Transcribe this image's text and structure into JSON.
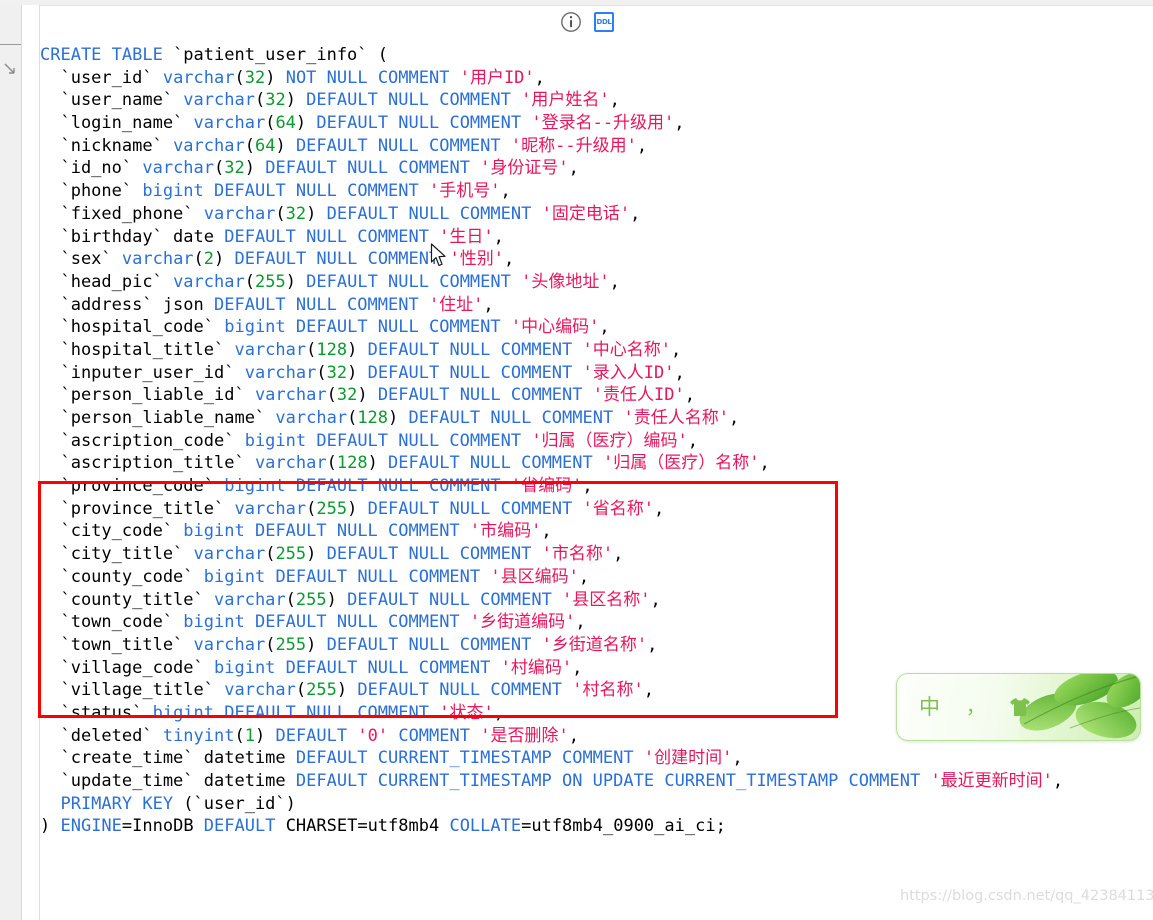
{
  "toolbar": {
    "info_icon": "info-circle-icon",
    "ddl_icon_label": "DDL"
  },
  "sidebar": {
    "collapse_icon": "chevron-collapse-icon"
  },
  "editor": {
    "language": "SQL",
    "statement_name": "CREATE TABLE patient_user_info",
    "colors": {
      "keyword": "#2b6fd8",
      "number": "#0a9a2e",
      "string": "#e8175d",
      "plain": "#000000",
      "annotation_box": "#ff0000"
    },
    "lines": [
      [
        {
          "t": "CREATE TABLE ",
          "c": "kw"
        },
        {
          "t": "`patient_user_info` (",
          "c": "plain"
        }
      ],
      [
        {
          "t": "  `user_id` ",
          "c": "plain"
        },
        {
          "t": "varchar",
          "c": "kw"
        },
        {
          "t": "(",
          "c": "plain"
        },
        {
          "t": "32",
          "c": "num"
        },
        {
          "t": ") ",
          "c": "plain"
        },
        {
          "t": "NOT NULL COMMENT ",
          "c": "kw"
        },
        {
          "t": "'用户ID'",
          "c": "str"
        },
        {
          "t": ",",
          "c": "plain"
        }
      ],
      [
        {
          "t": "  `user_name` ",
          "c": "plain"
        },
        {
          "t": "varchar",
          "c": "kw"
        },
        {
          "t": "(",
          "c": "plain"
        },
        {
          "t": "32",
          "c": "num"
        },
        {
          "t": ") ",
          "c": "plain"
        },
        {
          "t": "DEFAULT NULL COMMENT ",
          "c": "kw"
        },
        {
          "t": "'用户姓名'",
          "c": "str"
        },
        {
          "t": ",",
          "c": "plain"
        }
      ],
      [
        {
          "t": "  `login_name` ",
          "c": "plain"
        },
        {
          "t": "varchar",
          "c": "kw"
        },
        {
          "t": "(",
          "c": "plain"
        },
        {
          "t": "64",
          "c": "num"
        },
        {
          "t": ") ",
          "c": "plain"
        },
        {
          "t": "DEFAULT NULL COMMENT ",
          "c": "kw"
        },
        {
          "t": "'登录名--升级用'",
          "c": "str"
        },
        {
          "t": ",",
          "c": "plain"
        }
      ],
      [
        {
          "t": "  `nickname` ",
          "c": "plain"
        },
        {
          "t": "varchar",
          "c": "kw"
        },
        {
          "t": "(",
          "c": "plain"
        },
        {
          "t": "64",
          "c": "num"
        },
        {
          "t": ") ",
          "c": "plain"
        },
        {
          "t": "DEFAULT NULL COMMENT ",
          "c": "kw"
        },
        {
          "t": "'昵称--升级用'",
          "c": "str"
        },
        {
          "t": ",",
          "c": "plain"
        }
      ],
      [
        {
          "t": "  `id_no` ",
          "c": "plain"
        },
        {
          "t": "varchar",
          "c": "kw"
        },
        {
          "t": "(",
          "c": "plain"
        },
        {
          "t": "32",
          "c": "num"
        },
        {
          "t": ") ",
          "c": "plain"
        },
        {
          "t": "DEFAULT NULL COMMENT ",
          "c": "kw"
        },
        {
          "t": "'身份证号'",
          "c": "str"
        },
        {
          "t": ",",
          "c": "plain"
        }
      ],
      [
        {
          "t": "  `phone` ",
          "c": "plain"
        },
        {
          "t": "bigint",
          "c": "kw"
        },
        {
          "t": " ",
          "c": "plain"
        },
        {
          "t": "DEFAULT NULL COMMENT ",
          "c": "kw"
        },
        {
          "t": "'手机号'",
          "c": "str"
        },
        {
          "t": ",",
          "c": "plain"
        }
      ],
      [
        {
          "t": "  `fixed_phone` ",
          "c": "plain"
        },
        {
          "t": "varchar",
          "c": "kw"
        },
        {
          "t": "(",
          "c": "plain"
        },
        {
          "t": "32",
          "c": "num"
        },
        {
          "t": ") ",
          "c": "plain"
        },
        {
          "t": "DEFAULT NULL COMMENT ",
          "c": "kw"
        },
        {
          "t": "'固定电话'",
          "c": "str"
        },
        {
          "t": ",",
          "c": "plain"
        }
      ],
      [
        {
          "t": "  `birthday` date ",
          "c": "plain"
        },
        {
          "t": "DEFAULT NULL COMMENT ",
          "c": "kw"
        },
        {
          "t": "'生日'",
          "c": "str"
        },
        {
          "t": ",",
          "c": "plain"
        }
      ],
      [
        {
          "t": "  `sex` ",
          "c": "plain"
        },
        {
          "t": "varchar",
          "c": "kw"
        },
        {
          "t": "(",
          "c": "plain"
        },
        {
          "t": "2",
          "c": "num"
        },
        {
          "t": ") ",
          "c": "plain"
        },
        {
          "t": "DEFAULT NULL COMMENT ",
          "c": "kw"
        },
        {
          "t": "'性别'",
          "c": "str"
        },
        {
          "t": ",",
          "c": "plain"
        }
      ],
      [
        {
          "t": "  `head_pic` ",
          "c": "plain"
        },
        {
          "t": "varchar",
          "c": "kw"
        },
        {
          "t": "(",
          "c": "plain"
        },
        {
          "t": "255",
          "c": "num"
        },
        {
          "t": ") ",
          "c": "plain"
        },
        {
          "t": "DEFAULT NULL COMMENT ",
          "c": "kw"
        },
        {
          "t": "'头像地址'",
          "c": "str"
        },
        {
          "t": ",",
          "c": "plain"
        }
      ],
      [
        {
          "t": "  `address` json ",
          "c": "plain"
        },
        {
          "t": "DEFAULT NULL COMMENT ",
          "c": "kw"
        },
        {
          "t": "'住址'",
          "c": "str"
        },
        {
          "t": ",",
          "c": "plain"
        }
      ],
      [
        {
          "t": "  `hospital_code` ",
          "c": "plain"
        },
        {
          "t": "bigint",
          "c": "kw"
        },
        {
          "t": " ",
          "c": "plain"
        },
        {
          "t": "DEFAULT NULL COMMENT ",
          "c": "kw"
        },
        {
          "t": "'中心编码'",
          "c": "str"
        },
        {
          "t": ",",
          "c": "plain"
        }
      ],
      [
        {
          "t": "  `hospital_title` ",
          "c": "plain"
        },
        {
          "t": "varchar",
          "c": "kw"
        },
        {
          "t": "(",
          "c": "plain"
        },
        {
          "t": "128",
          "c": "num"
        },
        {
          "t": ") ",
          "c": "plain"
        },
        {
          "t": "DEFAULT NULL COMMENT ",
          "c": "kw"
        },
        {
          "t": "'中心名称'",
          "c": "str"
        },
        {
          "t": ",",
          "c": "plain"
        }
      ],
      [
        {
          "t": "  `inputer_user_id` ",
          "c": "plain"
        },
        {
          "t": "varchar",
          "c": "kw"
        },
        {
          "t": "(",
          "c": "plain"
        },
        {
          "t": "32",
          "c": "num"
        },
        {
          "t": ") ",
          "c": "plain"
        },
        {
          "t": "DEFAULT NULL COMMENT ",
          "c": "kw"
        },
        {
          "t": "'录入人ID'",
          "c": "str"
        },
        {
          "t": ",",
          "c": "plain"
        }
      ],
      [
        {
          "t": "  `person_liable_id` ",
          "c": "plain"
        },
        {
          "t": "varchar",
          "c": "kw"
        },
        {
          "t": "(",
          "c": "plain"
        },
        {
          "t": "32",
          "c": "num"
        },
        {
          "t": ") ",
          "c": "plain"
        },
        {
          "t": "DEFAULT NULL COMMENT ",
          "c": "kw"
        },
        {
          "t": "'责任人ID'",
          "c": "str"
        },
        {
          "t": ",",
          "c": "plain"
        }
      ],
      [
        {
          "t": "  `person_liable_name` ",
          "c": "plain"
        },
        {
          "t": "varchar",
          "c": "kw"
        },
        {
          "t": "(",
          "c": "plain"
        },
        {
          "t": "128",
          "c": "num"
        },
        {
          "t": ") ",
          "c": "plain"
        },
        {
          "t": "DEFAULT NULL COMMENT ",
          "c": "kw"
        },
        {
          "t": "'责任人名称'",
          "c": "str"
        },
        {
          "t": ",",
          "c": "plain"
        }
      ],
      [
        {
          "t": "  `ascription_code` ",
          "c": "plain"
        },
        {
          "t": "bigint",
          "c": "kw"
        },
        {
          "t": " ",
          "c": "plain"
        },
        {
          "t": "DEFAULT NULL COMMENT ",
          "c": "kw"
        },
        {
          "t": "'归属（医疗）编码'",
          "c": "str"
        },
        {
          "t": ",",
          "c": "plain"
        }
      ],
      [
        {
          "t": "  `ascription_title` ",
          "c": "plain"
        },
        {
          "t": "varchar",
          "c": "kw"
        },
        {
          "t": "(",
          "c": "plain"
        },
        {
          "t": "128",
          "c": "num"
        },
        {
          "t": ") ",
          "c": "plain"
        },
        {
          "t": "DEFAULT NULL COMMENT ",
          "c": "kw"
        },
        {
          "t": "'归属（医疗）名称'",
          "c": "str"
        },
        {
          "t": ",",
          "c": "plain"
        }
      ],
      [
        {
          "t": "  `province_code` ",
          "c": "plain"
        },
        {
          "t": "bigint",
          "c": "kw"
        },
        {
          "t": " ",
          "c": "plain"
        },
        {
          "t": "DEFAULT NULL COMMENT ",
          "c": "kw"
        },
        {
          "t": "'省编码'",
          "c": "str"
        },
        {
          "t": ",",
          "c": "plain"
        }
      ],
      [
        {
          "t": "  `province_title` ",
          "c": "plain"
        },
        {
          "t": "varchar",
          "c": "kw"
        },
        {
          "t": "(",
          "c": "plain"
        },
        {
          "t": "255",
          "c": "num"
        },
        {
          "t": ") ",
          "c": "plain"
        },
        {
          "t": "DEFAULT NULL COMMENT ",
          "c": "kw"
        },
        {
          "t": "'省名称'",
          "c": "str"
        },
        {
          "t": ",",
          "c": "plain"
        }
      ],
      [
        {
          "t": "  `city_code` ",
          "c": "plain"
        },
        {
          "t": "bigint",
          "c": "kw"
        },
        {
          "t": " ",
          "c": "plain"
        },
        {
          "t": "DEFAULT NULL COMMENT ",
          "c": "kw"
        },
        {
          "t": "'市编码'",
          "c": "str"
        },
        {
          "t": ",",
          "c": "plain"
        }
      ],
      [
        {
          "t": "  `city_title` ",
          "c": "plain"
        },
        {
          "t": "varchar",
          "c": "kw"
        },
        {
          "t": "(",
          "c": "plain"
        },
        {
          "t": "255",
          "c": "num"
        },
        {
          "t": ") ",
          "c": "plain"
        },
        {
          "t": "DEFAULT NULL COMMENT ",
          "c": "kw"
        },
        {
          "t": "'市名称'",
          "c": "str"
        },
        {
          "t": ",",
          "c": "plain"
        }
      ],
      [
        {
          "t": "  `county_code` ",
          "c": "plain"
        },
        {
          "t": "bigint",
          "c": "kw"
        },
        {
          "t": " ",
          "c": "plain"
        },
        {
          "t": "DEFAULT NULL COMMENT ",
          "c": "kw"
        },
        {
          "t": "'县区编码'",
          "c": "str"
        },
        {
          "t": ",",
          "c": "plain"
        }
      ],
      [
        {
          "t": "  `county_title` ",
          "c": "plain"
        },
        {
          "t": "varchar",
          "c": "kw"
        },
        {
          "t": "(",
          "c": "plain"
        },
        {
          "t": "255",
          "c": "num"
        },
        {
          "t": ") ",
          "c": "plain"
        },
        {
          "t": "DEFAULT NULL COMMENT ",
          "c": "kw"
        },
        {
          "t": "'县区名称'",
          "c": "str"
        },
        {
          "t": ",",
          "c": "plain"
        }
      ],
      [
        {
          "t": "  `town_code` ",
          "c": "plain"
        },
        {
          "t": "bigint",
          "c": "kw"
        },
        {
          "t": " ",
          "c": "plain"
        },
        {
          "t": "DEFAULT NULL COMMENT ",
          "c": "kw"
        },
        {
          "t": "'乡街道编码'",
          "c": "str"
        },
        {
          "t": ",",
          "c": "plain"
        }
      ],
      [
        {
          "t": "  `town_title` ",
          "c": "plain"
        },
        {
          "t": "varchar",
          "c": "kw"
        },
        {
          "t": "(",
          "c": "plain"
        },
        {
          "t": "255",
          "c": "num"
        },
        {
          "t": ") ",
          "c": "plain"
        },
        {
          "t": "DEFAULT NULL COMMENT ",
          "c": "kw"
        },
        {
          "t": "'乡街道名称'",
          "c": "str"
        },
        {
          "t": ",",
          "c": "plain"
        }
      ],
      [
        {
          "t": "  `village_code` ",
          "c": "plain"
        },
        {
          "t": "bigint",
          "c": "kw"
        },
        {
          "t": " ",
          "c": "plain"
        },
        {
          "t": "DEFAULT NULL COMMENT ",
          "c": "kw"
        },
        {
          "t": "'村编码'",
          "c": "str"
        },
        {
          "t": ",",
          "c": "plain"
        }
      ],
      [
        {
          "t": "  `village_title` ",
          "c": "plain"
        },
        {
          "t": "varchar",
          "c": "kw"
        },
        {
          "t": "(",
          "c": "plain"
        },
        {
          "t": "255",
          "c": "num"
        },
        {
          "t": ") ",
          "c": "plain"
        },
        {
          "t": "DEFAULT NULL COMMENT ",
          "c": "kw"
        },
        {
          "t": "'村名称'",
          "c": "str"
        },
        {
          "t": ",",
          "c": "plain"
        }
      ],
      [
        {
          "t": "  `status` ",
          "c": "plain"
        },
        {
          "t": "bigint",
          "c": "kw"
        },
        {
          "t": " ",
          "c": "plain"
        },
        {
          "t": "DEFAULT NULL COMMENT ",
          "c": "kw"
        },
        {
          "t": "'状态'",
          "c": "str"
        },
        {
          "t": ",",
          "c": "plain"
        }
      ],
      [
        {
          "t": "  `deleted` ",
          "c": "plain"
        },
        {
          "t": "tinyint",
          "c": "kw"
        },
        {
          "t": "(",
          "c": "plain"
        },
        {
          "t": "1",
          "c": "num"
        },
        {
          "t": ") ",
          "c": "plain"
        },
        {
          "t": "DEFAULT ",
          "c": "kw"
        },
        {
          "t": "'0'",
          "c": "str"
        },
        {
          "t": " ",
          "c": "plain"
        },
        {
          "t": "COMMENT ",
          "c": "kw"
        },
        {
          "t": "'是否删除'",
          "c": "str"
        },
        {
          "t": ",",
          "c": "plain"
        }
      ],
      [
        {
          "t": "  `create_time` datetime ",
          "c": "plain"
        },
        {
          "t": "DEFAULT CURRENT_TIMESTAMP COMMENT ",
          "c": "kw"
        },
        {
          "t": "'创建时间'",
          "c": "str"
        },
        {
          "t": ",",
          "c": "plain"
        }
      ],
      [
        {
          "t": "  `update_time` datetime ",
          "c": "plain"
        },
        {
          "t": "DEFAULT CURRENT_TIMESTAMP ON UPDATE CURRENT_TIMESTAMP COMMENT ",
          "c": "kw"
        },
        {
          "t": "'最近更新时间'",
          "c": "str"
        },
        {
          "t": ",",
          "c": "plain"
        }
      ],
      [
        {
          "t": "  PRIMARY KEY ",
          "c": "kw"
        },
        {
          "t": "(`user_id`)",
          "c": "plain"
        }
      ],
      [
        {
          "t": ") ",
          "c": "plain"
        },
        {
          "t": "ENGINE",
          "c": "kw"
        },
        {
          "t": "=InnoDB ",
          "c": "plain"
        },
        {
          "t": "DEFAULT ",
          "c": "kw"
        },
        {
          "t": "CHARSET=utf8mb4 ",
          "c": "plain"
        },
        {
          "t": "COLLATE",
          "c": "kw"
        },
        {
          "t": "=utf8mb4_0900_ai_ci;",
          "c": "plain"
        }
      ]
    ]
  },
  "annotation": {
    "highlight_note": "region-of-interest red rectangle around province/city/county/town/village columns"
  },
  "ime": {
    "language_label": "中",
    "punctuation_label": "，",
    "skin_icon": "ime-skin-icon"
  },
  "watermark": {
    "text": "https://blog.csdn.net/qq_42384113"
  }
}
